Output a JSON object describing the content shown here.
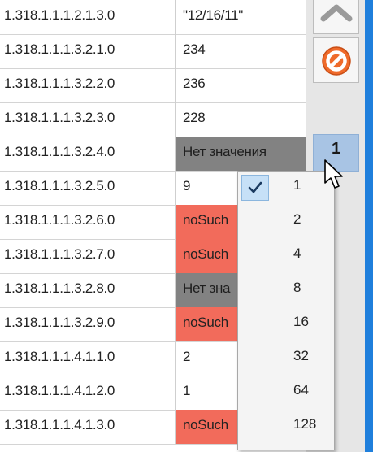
{
  "rows": [
    {
      "oid": "1.318.1.1.1.2.1.3.0",
      "value": "\"12/16/11\"",
      "status": "normal"
    },
    {
      "oid": "1.318.1.1.1.3.2.1.0",
      "value": "234",
      "status": "normal"
    },
    {
      "oid": "1.318.1.1.1.3.2.2.0",
      "value": "236",
      "status": "normal"
    },
    {
      "oid": "1.318.1.1.1.3.2.3.0",
      "value": "228",
      "status": "normal"
    },
    {
      "oid": "1.318.1.1.1.3.2.4.0",
      "value": "Нет значения",
      "status": "novalue"
    },
    {
      "oid": "1.318.1.1.1.3.2.5.0",
      "value": "9",
      "status": "normal"
    },
    {
      "oid": "1.318.1.1.1.3.2.6.0",
      "value": "noSuch",
      "status": "nosuch"
    },
    {
      "oid": "1.318.1.1.1.3.2.7.0",
      "value": "noSuch",
      "status": "nosuch"
    },
    {
      "oid": "1.318.1.1.1.3.2.8.0",
      "value": "Нет зна",
      "status": "novalue"
    },
    {
      "oid": "1.318.1.1.1.3.2.9.0",
      "value": "noSuch",
      "status": "nosuch"
    },
    {
      "oid": "1.318.1.1.1.4.1.1.0",
      "value": "2",
      "status": "normal"
    },
    {
      "oid": "1.318.1.1.1.4.1.2.0",
      "value": "1",
      "status": "normal"
    },
    {
      "oid": "1.318.1.1.1.4.1.3.0",
      "value": "noSuch",
      "status": "nosuch"
    }
  ],
  "page_button": {
    "label": "1"
  },
  "dropdown": {
    "selected": "1",
    "options": [
      "1",
      "2",
      "4",
      "8",
      "16",
      "32",
      "64",
      "128"
    ]
  },
  "icons": {
    "back": "back-arrow-icon",
    "cancel": "cancel-icon",
    "cursor": "mouse-pointer-icon"
  },
  "colors": {
    "nosuch": "#f26b5b",
    "novalue": "#828282",
    "selected_option": "#c6e0f7",
    "accent": "#1f7fdc"
  }
}
